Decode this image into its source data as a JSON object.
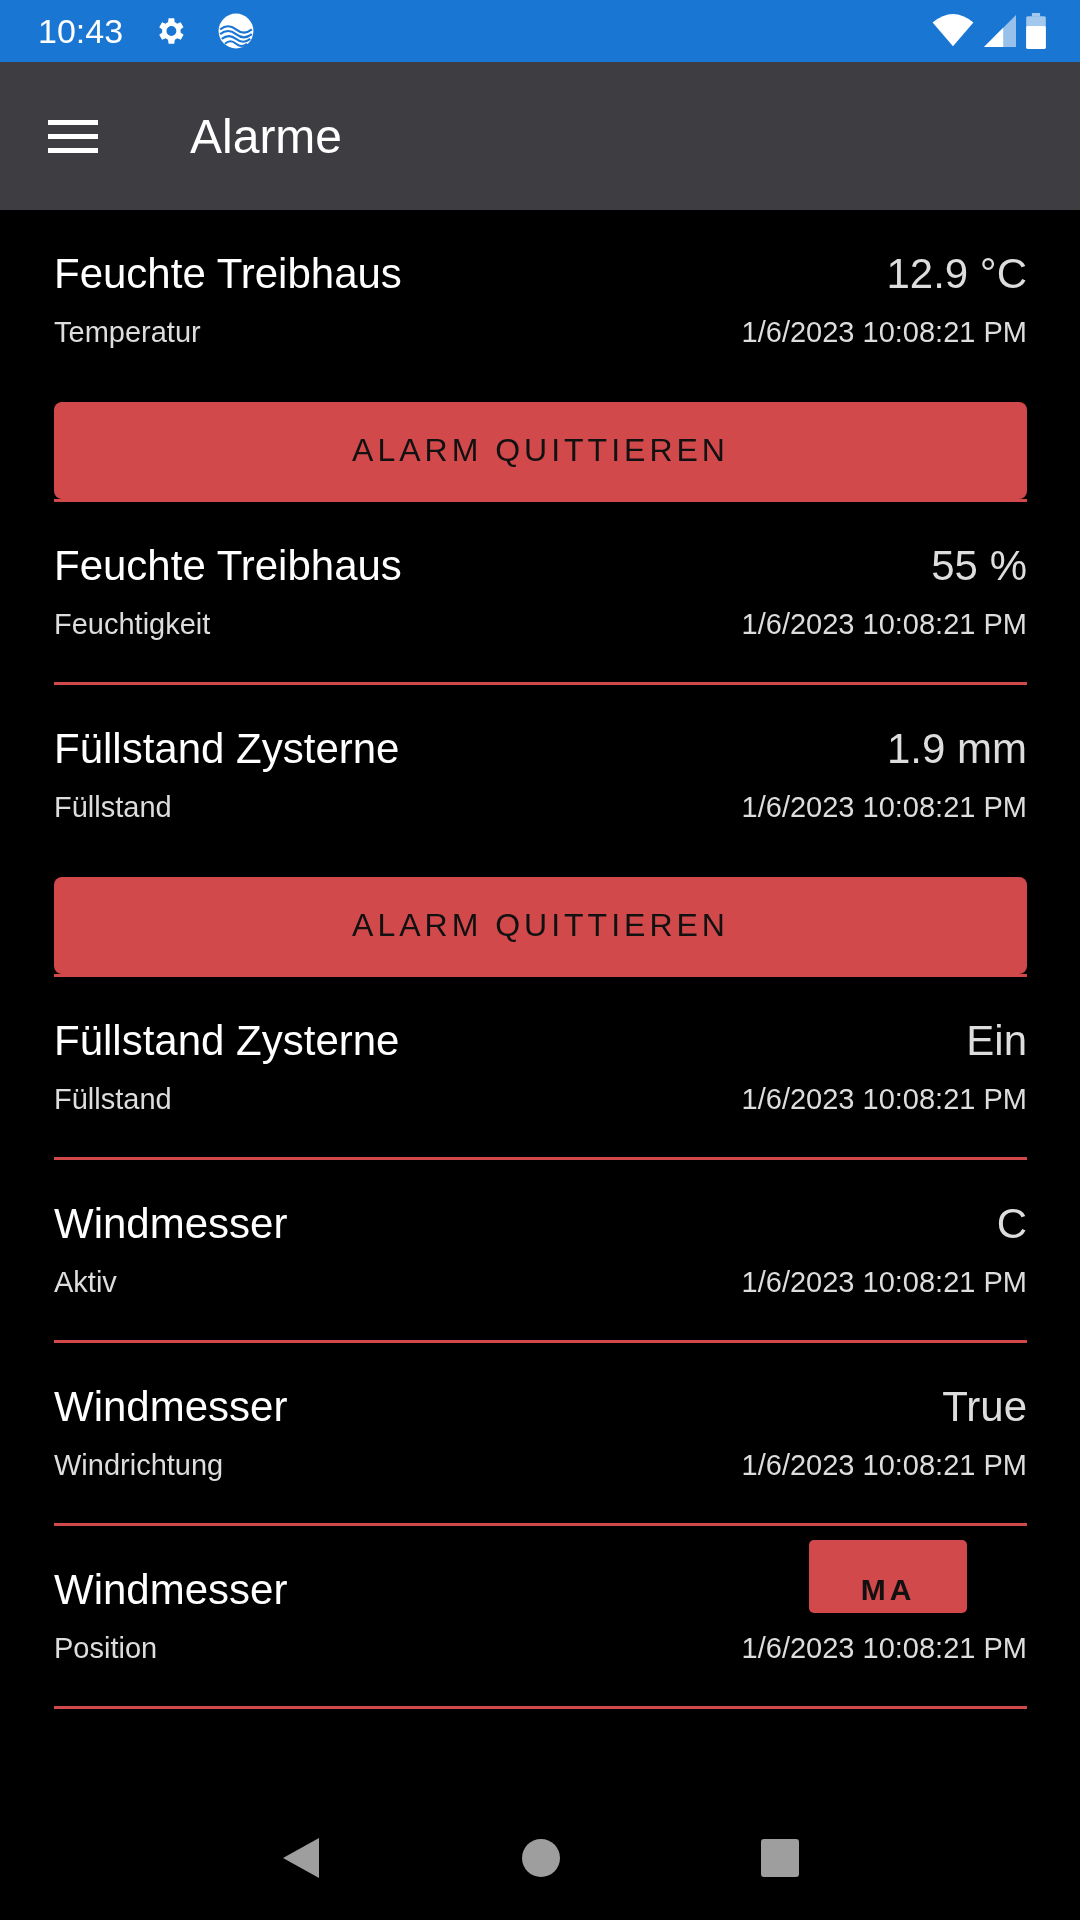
{
  "status_bar": {
    "time": "10:43"
  },
  "toolbar": {
    "title": "Alarme"
  },
  "alarms": [
    {
      "name": "Feuchte Treibhaus",
      "value": "12.9 °C",
      "type": "Temperatur",
      "timestamp": "1/6/2023 10:08:21 PM",
      "action": "ALARM QUITTIEREN"
    },
    {
      "name": "Feuchte Treibhaus",
      "value": "55 %",
      "type": "Feuchtigkeit",
      "timestamp": "1/6/2023 10:08:21 PM"
    },
    {
      "name": "Füllstand Zysterne",
      "value": "1.9 mm",
      "type": "Füllstand",
      "timestamp": "1/6/2023 10:08:21 PM",
      "action": "ALARM QUITTIEREN"
    },
    {
      "name": "Füllstand Zysterne",
      "value": "Ein",
      "type": "Füllstand",
      "timestamp": "1/6/2023 10:08:21 PM"
    },
    {
      "name": "Windmesser",
      "value": "C",
      "type": "Aktiv",
      "timestamp": "1/6/2023 10:08:21 PM"
    },
    {
      "name": "Windmesser",
      "value": "True",
      "type": "Windrichtung",
      "timestamp": "1/6/2023 10:08:21 PM"
    },
    {
      "name": "Windmesser",
      "type": "Position",
      "timestamp": "1/6/2023 10:08:21 PM",
      "overlay_button": "MA"
    }
  ]
}
